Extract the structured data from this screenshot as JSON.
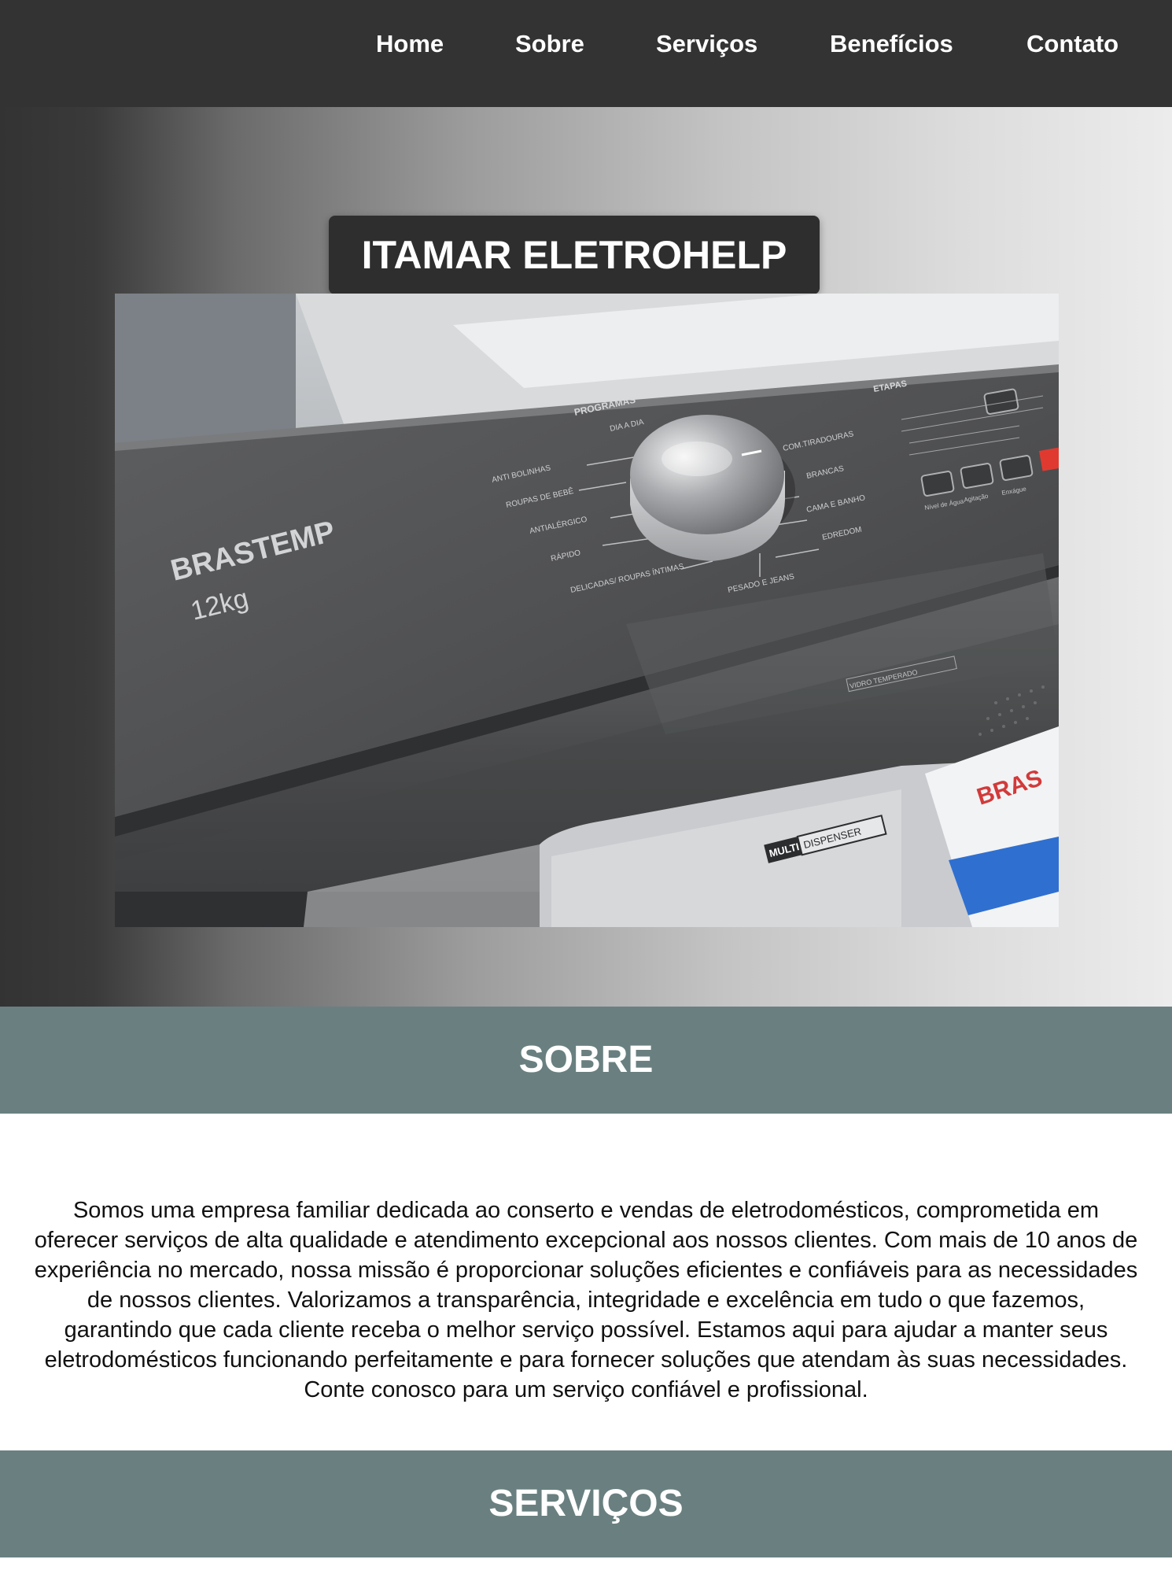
{
  "nav": {
    "items": [
      "Home",
      "Sobre",
      "Serviços",
      "Benefícios",
      "Contato"
    ]
  },
  "hero": {
    "title": "ITAMAR ELETROHELP",
    "photo": {
      "brand": "BRASTEMP",
      "capacity": "12kg",
      "programs_label": "PROGRAMAS",
      "steps_label": "ETAPAS",
      "programs_left": [
        "ANTI BOLINHAS",
        "ROUPAS DE BEBÊ",
        "ANTIALÉRGICO",
        "RÁPIDO",
        "DELICADAS/ ROUPAS ÍNTIMAS"
      ],
      "programs_top": [
        "DIA A DIA"
      ],
      "programs_right": [
        "COM.TIRADOURAS",
        "BRANCAS",
        "CAMA E BANHO",
        "EDREDOM",
        "PESADO E JEANS"
      ],
      "steps_buttons": [
        "Nível de Água",
        "Agitação",
        "Enxágue"
      ],
      "glass_label": "VIDRO TEMPERADO",
      "dispenser_label_a": "MULTI",
      "dispenser_label_b": "DISPENSER",
      "packet_text": "BRAS"
    }
  },
  "sobre": {
    "heading": "SOBRE",
    "text": "Somos uma empresa familiar dedicada ao conserto e vendas de eletrodomésticos, comprometida em oferecer serviços de alta qualidade e atendimento excepcional aos nossos clientes. Com mais de 10 anos de experiência no mercado, nossa missão é proporcionar soluções eficientes e confiáveis para as necessidades de nossos clientes. Valorizamos a transparência, integridade e excelência em tudo o que fazemos, garantindo que cada cliente receba o melhor serviço possível. Estamos aqui para ajudar a manter seus eletrodomésticos funcionando perfeitamente e para fornecer soluções que atendam às suas necessidades. Conte conosco para um serviço confiável e profissional."
  },
  "servicos": {
    "heading": "SERVIÇOS"
  },
  "colors": {
    "nav_bg": "#333333",
    "band_bg": "#6a8080",
    "title_box_bg": "#2e2e2e"
  }
}
